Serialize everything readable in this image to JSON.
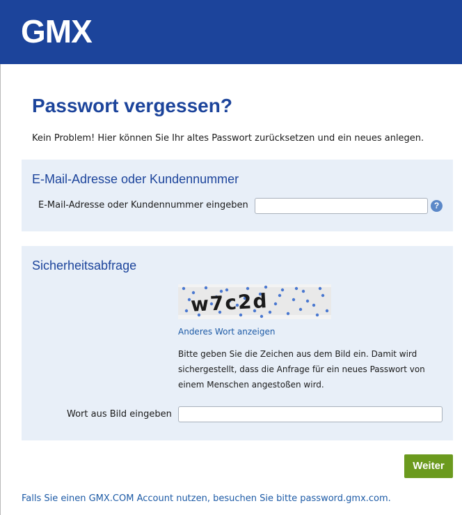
{
  "header": {
    "logo_text": "GMX",
    "bg_color": "#1c449b"
  },
  "page": {
    "title": "Passwort vergessen?",
    "intro": "Kein Problem! Hier können Sie Ihr altes Passwort zurücksetzen und ein neues anlegen."
  },
  "account_section": {
    "title": "E-Mail-Adresse oder Kundennummer",
    "field_label": "E-Mail-Adresse oder Kundennummer eingeben",
    "field_value": "",
    "help_icon": "?"
  },
  "security_section": {
    "title": "Sicherheitsabfrage",
    "captcha_text": "w7c2d",
    "refresh_link": "Anderes Wort anzeigen",
    "hint": "Bitte geben Sie die Zeichen aus dem Bild ein. Damit wird sichergestellt, dass die Anfrage für ein neues Passwort von einem Menschen angestoßen wird.",
    "field_label": "Wort aus Bild eingeben",
    "field_value": ""
  },
  "actions": {
    "submit_label": "Weiter",
    "submit_color": "#6b9a1e"
  },
  "footer": {
    "link_text": "Falls Sie einen GMX.COM Account nutzen, besuchen Sie bitte password.gmx.com."
  }
}
